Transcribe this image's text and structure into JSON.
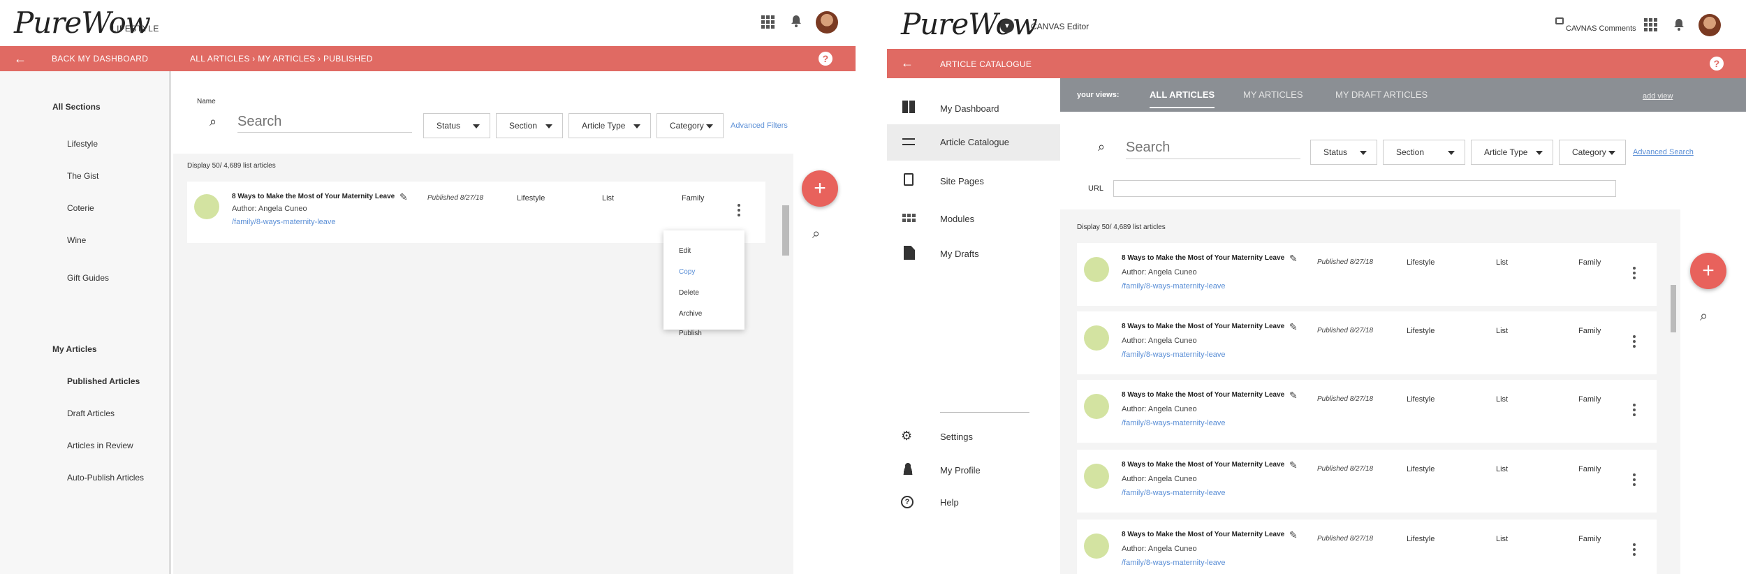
{
  "left": {
    "logo": "PureWow",
    "logo_sub": "LIFESTYLE",
    "redbar": {
      "back": "BACK MY DASHBOARD",
      "breadcrumb": "ALL ARTICLES › MY ARTICLES › PUBLISHED",
      "help": "?"
    },
    "sidebar": {
      "all_sections": "All Sections",
      "sections": [
        "Lifestyle",
        "The Gist",
        "Coterie",
        "Wine",
        "Gift Guides"
      ],
      "my_articles": "My Articles",
      "articles": [
        "Published Articles",
        "Draft Articles",
        "Articles in Review",
        "Auto-Publish Articles"
      ]
    },
    "name_label": "Name",
    "search_placeholder": "Search",
    "filters": {
      "status": "Status",
      "section": "Section",
      "article_type": "Article Type",
      "category": "Category",
      "advanced": "Advanced Filters"
    },
    "display_count": "Display 50/ 4,689 list articles",
    "row": {
      "title": "8 Ways to Make the Most of Your Maternity Leave",
      "author": "Author: Angela Cuneo",
      "url": "/family/8-ways-maternity-leave",
      "published": "Published  8/27/18",
      "section": "Lifestyle",
      "type": "List",
      "category": "Family"
    },
    "menu": [
      "Edit",
      "Copy",
      "Delete",
      "Archive",
      "Publish"
    ],
    "fab": "+"
  },
  "right": {
    "logo": "PureWow",
    "logo_sub": "CANVAS Editor",
    "comments": "CAVNAS Comments",
    "redbar": {
      "title": "ARTICLE CATALOGUE",
      "help": "?"
    },
    "sidebar": {
      "items": [
        "My Dashboard",
        "Article Catalogue",
        "Site Pages",
        "Modules",
        "My Drafts"
      ],
      "bottom": [
        "Settings",
        "My Profile",
        "Help"
      ]
    },
    "views": {
      "label": "your views:",
      "tabs": [
        "ALL ARTICLES",
        "MY ARTICLES",
        "MY DRAFT ARTICLES"
      ],
      "add": "add view"
    },
    "search_placeholder": "Search",
    "filters": {
      "status": "Status",
      "section": "Section",
      "article_type": "Article Type",
      "category": "Category",
      "advanced": "Advanced Search"
    },
    "url_label": "URL",
    "display_count": "Display 50/ 4,689 list articles",
    "rows": [
      {
        "title": "8 Ways to Make the Most of Your Maternity Leave",
        "author": "Author: Angela Cuneo",
        "url": "/family/8-ways-maternity-leave",
        "published": "Published  8/27/18",
        "section": "Lifestyle",
        "type": "List",
        "category": "Family"
      },
      {
        "title": "8 Ways to Make the Most of Your Maternity Leave",
        "author": "Author: Angela Cuneo",
        "url": "/family/8-ways-maternity-leave",
        "published": "Published  8/27/18",
        "section": "Lifestyle",
        "type": "List",
        "category": "Family"
      },
      {
        "title": "8 Ways to Make the Most of Your Maternity Leave",
        "author": "Author: Angela Cuneo",
        "url": "/family/8-ways-maternity-leave",
        "published": "Published  8/27/18",
        "section": "Lifestyle",
        "type": "List",
        "category": "Family"
      },
      {
        "title": "8 Ways to Make the Most of Your Maternity Leave",
        "author": "Author: Angela Cuneo",
        "url": "/family/8-ways-maternity-leave",
        "published": "Published  8/27/18",
        "section": "Lifestyle",
        "type": "List",
        "category": "Family"
      },
      {
        "title": "8 Ways to Make the Most of Your Maternity Leave",
        "author": "Author: Angela Cuneo",
        "url": "/family/8-ways-maternity-leave",
        "published": "Published  8/27/18",
        "section": "Lifestyle",
        "type": "List",
        "category": "Family"
      }
    ],
    "fab": "+"
  }
}
